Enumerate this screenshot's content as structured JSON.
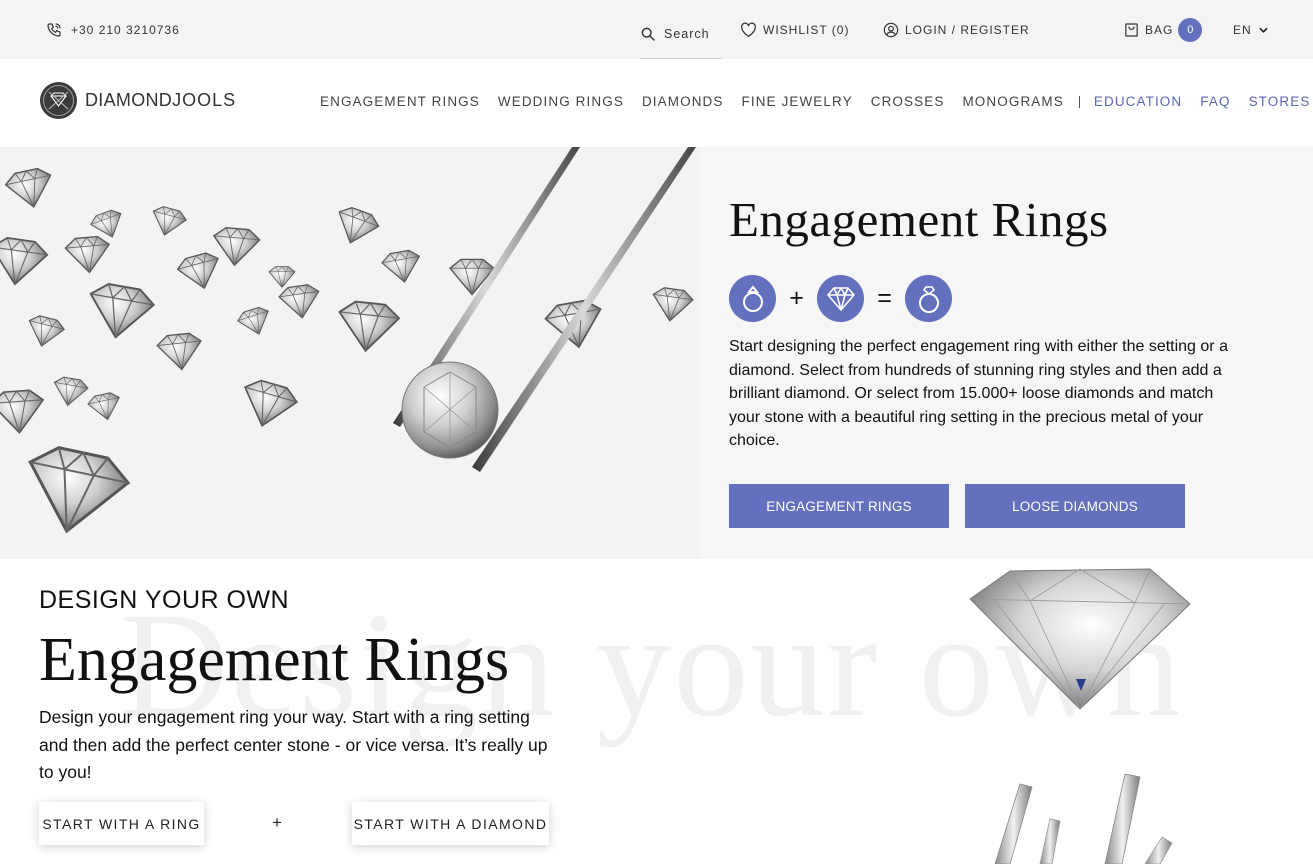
{
  "topbar": {
    "phone": "+30 210 3210736",
    "search_label": "Search",
    "wishlist_label": "WISHLIST (0)",
    "login_label": "LOGIN / REGISTER",
    "bag_label": "BAG",
    "bag_count": "0",
    "language": "EN"
  },
  "header": {
    "logo_part1": "DIAMOND",
    "logo_part2": "JOOLS",
    "nav": [
      "ENGAGEMENT RINGS",
      "WEDDING RINGS",
      "DIAMONDS",
      "FINE JEWELRY",
      "CROSSES",
      "MONOGRAMS",
      "EDUCATION",
      "FAQ",
      "STORES"
    ]
  },
  "hero": {
    "title": "Engagement Rings",
    "formula_plus": "+",
    "formula_equals": "=",
    "description": "Start designing the perfect engagement ring with either the setting or a diamond. Select from hundreds of stunning ring styles and then add a brilliant diamond. Or select from 15.000+ loose diamonds and match your stone with a beautiful ring setting in the precious metal of your choice.",
    "btn_engagement": "ENGAGEMENT RINGS",
    "btn_loose": "LOOSE DIAMONDS"
  },
  "design": {
    "ghost_text": "Design your own",
    "kicker": "DESIGN YOUR OWN",
    "title": "Engagement Rings",
    "description": "Design your engagement ring your way. Start with a ring setting and then add the perfect center stone - or vice versa. It’s really up to you!",
    "btn_ring": "START WITH A RING",
    "plus": "+",
    "btn_diamond": "START WITH A DIAMOND"
  },
  "colors": {
    "accent": "#6270bd",
    "topbar_bg": "#f4f4f4",
    "hero_bg": "#f6f6f6"
  },
  "icons": {
    "phone": "phone-icon",
    "search": "search-icon",
    "wishlist": "heart-icon",
    "login": "user-circle-icon",
    "bag": "shopping-bag-icon",
    "language": "chevron-down-icon",
    "formula": [
      "ring-icon",
      "diamond-icon",
      "diamond-ring-icon"
    ]
  }
}
